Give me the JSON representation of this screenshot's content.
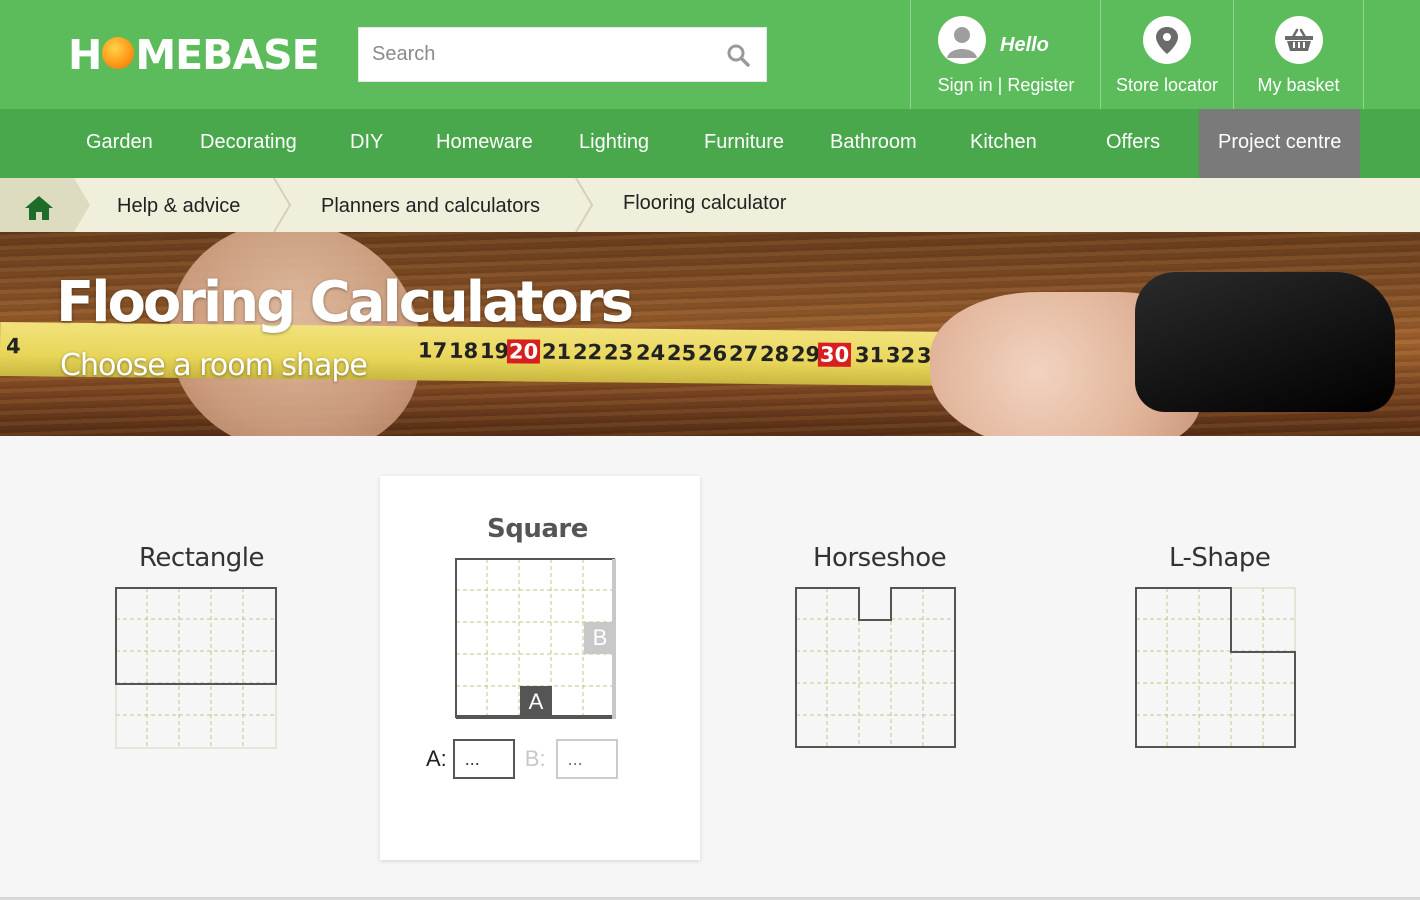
{
  "header": {
    "logo_text": "HOMEBASE",
    "search": {
      "placeholder": "Search"
    },
    "account": {
      "greeting": "Hello",
      "label": "Sign in | Register"
    },
    "store": {
      "label": "Store locator"
    },
    "basket": {
      "label": "My basket"
    }
  },
  "nav": {
    "items": [
      {
        "label": "Garden"
      },
      {
        "label": "Decorating"
      },
      {
        "label": "DIY"
      },
      {
        "label": "Homeware"
      },
      {
        "label": "Lighting"
      },
      {
        "label": "Furniture"
      },
      {
        "label": "Bathroom"
      },
      {
        "label": "Kitchen"
      },
      {
        "label": "Offers"
      },
      {
        "label": "Project centre",
        "active": true
      }
    ]
  },
  "breadcrumb": {
    "items": [
      {
        "label": "Help & advice"
      },
      {
        "label": "Planners and calculators"
      },
      {
        "label": "Flooring calculator"
      }
    ]
  },
  "hero": {
    "title": "Flooring Calculators",
    "subtitle": "Choose a room shape",
    "tape_numbers": [
      "4",
      "17",
      "18",
      "19",
      "20",
      "21",
      "22",
      "23",
      "24",
      "25",
      "26",
      "27",
      "28",
      "29",
      "30",
      "31",
      "32",
      "33"
    ]
  },
  "shapes": [
    {
      "label": "Rectangle",
      "selected": false
    },
    {
      "label": "Square",
      "selected": true
    },
    {
      "label": "Horseshoe",
      "selected": false
    },
    {
      "label": "L-Shape",
      "selected": false
    }
  ],
  "square_form": {
    "dim_a_marker": "A",
    "dim_b_marker": "B",
    "a_label": "A:",
    "b_label": "B:",
    "a_value": "...",
    "b_placeholder": "..."
  },
  "colors": {
    "header_green": "#5cbc5c",
    "nav_green": "#49a74c",
    "active_nav": "#7a7a7a",
    "breadcrumb_bg": "#f0efdc",
    "grid_dash": "#b9c98a"
  }
}
